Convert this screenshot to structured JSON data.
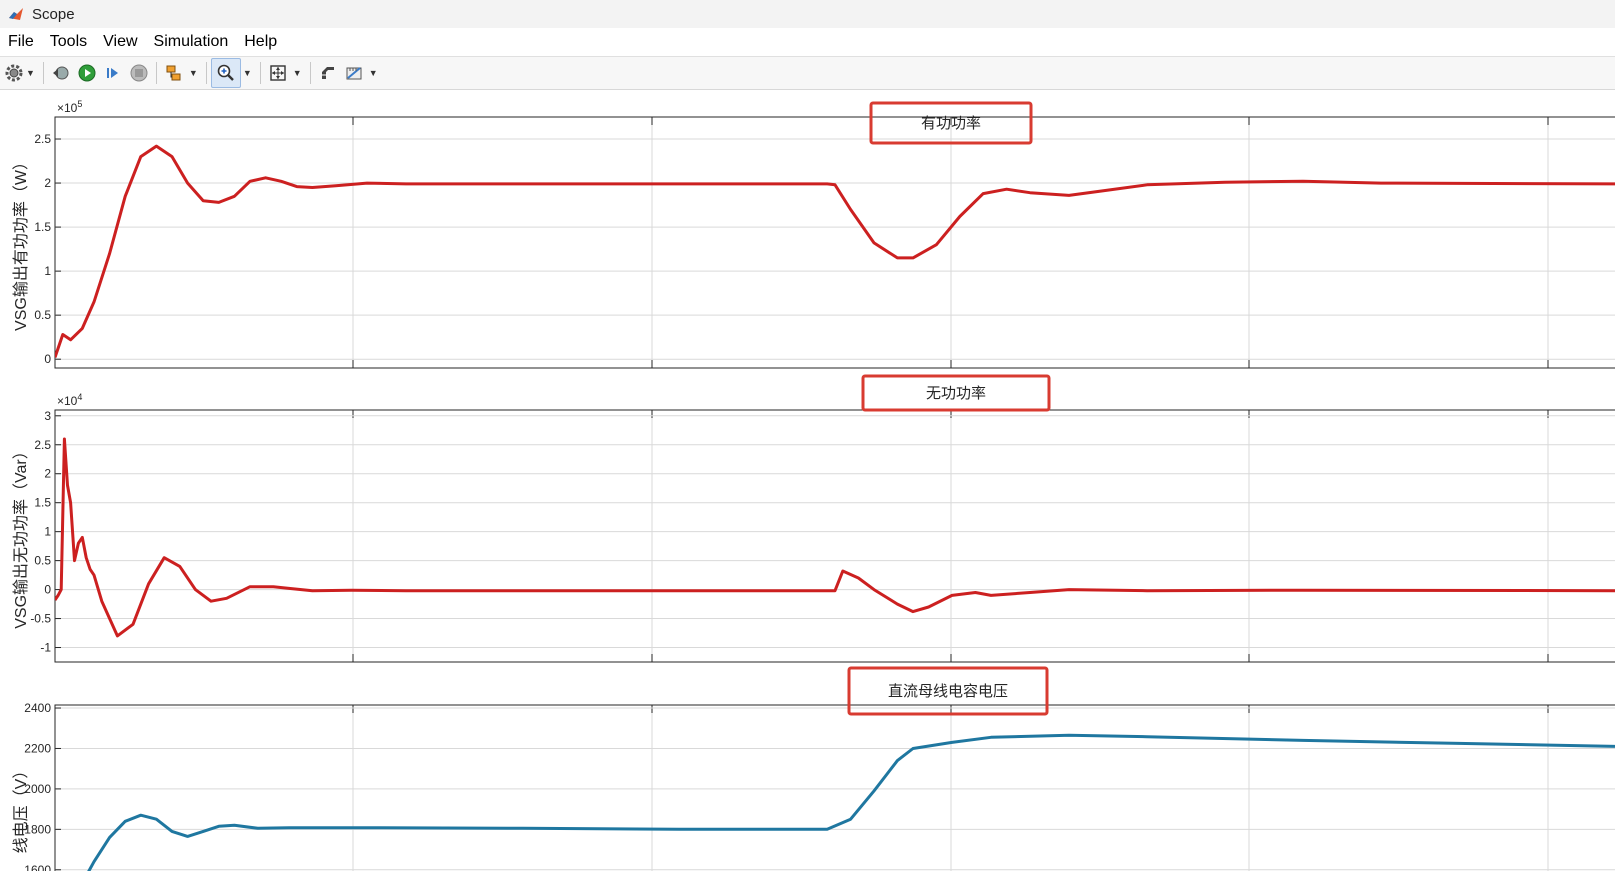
{
  "window": {
    "title": "Scope"
  },
  "menu": [
    "File",
    "Tools",
    "View",
    "Simulation",
    "Help"
  ],
  "toolbar_icons": [
    "gear-icon",
    "restore-icon",
    "run-icon",
    "step-forward-icon",
    "stop-icon",
    "signal-select-icon",
    "zoom-in-icon",
    "autoscale-icon",
    "style-icon",
    "measure-icon"
  ],
  "colors": {
    "accent_red": "#d0312d",
    "trace_red": "#cc2020",
    "trace_blue": "#1f77a0",
    "highlight": "#d83b31"
  },
  "chart_data": [
    {
      "type": "line",
      "title": "有功功率",
      "ylabel": "VSG输出有功功率（W）",
      "y_exponent": "5",
      "ylim": [
        -0.1,
        2.75
      ],
      "yticks": [
        "0",
        "0.5",
        "1",
        "1.5",
        "2",
        "2.5"
      ],
      "ytick_values": [
        0,
        0.5,
        1,
        1.5,
        2,
        2.5
      ],
      "grid": true,
      "series": [
        {
          "color": "#cc2020",
          "x": [
            0,
            0.01,
            0.02,
            0.035,
            0.05,
            0.07,
            0.09,
            0.11,
            0.13,
            0.15,
            0.17,
            0.19,
            0.21,
            0.23,
            0.25,
            0.27,
            0.29,
            0.31,
            0.33,
            0.36,
            0.4,
            0.45,
            0.6,
            0.8,
            0.99,
            1.0,
            1.02,
            1.05,
            1.08,
            1.1,
            1.13,
            1.16,
            1.19,
            1.22,
            1.25,
            1.3,
            1.35,
            1.4,
            1.5,
            1.6,
            1.7,
            2.0
          ],
          "y": [
            0.02,
            0.28,
            0.22,
            0.35,
            0.65,
            1.2,
            1.85,
            2.3,
            2.42,
            2.3,
            2.0,
            1.8,
            1.78,
            1.85,
            2.02,
            2.06,
            2.02,
            1.96,
            1.95,
            1.97,
            2.0,
            1.99,
            1.99,
            1.99,
            1.99,
            1.98,
            1.7,
            1.32,
            1.15,
            1.15,
            1.3,
            1.62,
            1.88,
            1.93,
            1.89,
            1.86,
            1.92,
            1.98,
            2.01,
            2.02,
            2.0,
            1.99
          ]
        }
      ]
    },
    {
      "type": "line",
      "title": "无功功率",
      "ylabel": "VSG输出无功功率（Var）",
      "y_exponent": "4",
      "ylim": [
        -1.25,
        3.1
      ],
      "yticks": [
        "-1",
        "-0.5",
        "0",
        "0.5",
        "1",
        "1.5",
        "2",
        "2.5",
        "3"
      ],
      "ytick_values": [
        -1,
        -0.5,
        0,
        0.5,
        1,
        1.5,
        2,
        2.5,
        3
      ],
      "grid": true,
      "series": [
        {
          "color": "#cc2020",
          "x": [
            0,
            0.004,
            0.008,
            0.012,
            0.016,
            0.02,
            0.025,
            0.03,
            0.035,
            0.04,
            0.045,
            0.05,
            0.06,
            0.08,
            0.1,
            0.12,
            0.14,
            0.16,
            0.18,
            0.2,
            0.22,
            0.25,
            0.28,
            0.3,
            0.33,
            0.38,
            0.45,
            0.6,
            0.8,
            1.0,
            1.01,
            1.03,
            1.05,
            1.08,
            1.1,
            1.12,
            1.15,
            1.18,
            1.2,
            1.25,
            1.3,
            1.4,
            1.6,
            2.0
          ],
          "y": [
            -0.18,
            -0.1,
            0.0,
            2.6,
            1.8,
            1.5,
            0.5,
            0.8,
            0.9,
            0.55,
            0.35,
            0.25,
            -0.2,
            -0.8,
            -0.6,
            0.1,
            0.55,
            0.4,
            0.0,
            -0.2,
            -0.15,
            0.05,
            0.05,
            0.02,
            -0.02,
            -0.01,
            -0.02,
            -0.02,
            -0.02,
            -0.02,
            0.32,
            0.2,
            0.0,
            -0.25,
            -0.38,
            -0.3,
            -0.1,
            -0.05,
            -0.1,
            -0.05,
            0.0,
            -0.02,
            -0.01,
            -0.02
          ]
        }
      ]
    },
    {
      "type": "line",
      "title": "直流母线电容电压",
      "ylabel": "线电压（V）",
      "ylim": [
        1500,
        2415
      ],
      "yticks": [
        "1600",
        "1800",
        "2000",
        "2200",
        "2400"
      ],
      "ytick_values": [
        1600,
        1800,
        2000,
        2200,
        2400
      ],
      "grid": true,
      "series": [
        {
          "color": "#1f77a0",
          "x": [
            0.03,
            0.05,
            0.07,
            0.09,
            0.11,
            0.13,
            0.15,
            0.17,
            0.19,
            0.21,
            0.23,
            0.26,
            0.3,
            0.4,
            0.6,
            0.8,
            0.99,
            1.02,
            1.05,
            1.08,
            1.1,
            1.15,
            1.2,
            1.3,
            1.4,
            1.6,
            1.8,
            2.0
          ],
          "y": [
            1500,
            1640,
            1760,
            1840,
            1870,
            1850,
            1790,
            1765,
            1790,
            1815,
            1820,
            1805,
            1808,
            1808,
            1805,
            1800,
            1800,
            1850,
            1990,
            2140,
            2200,
            2230,
            2255,
            2265,
            2258,
            2240,
            2225,
            2210
          ]
        }
      ]
    }
  ]
}
